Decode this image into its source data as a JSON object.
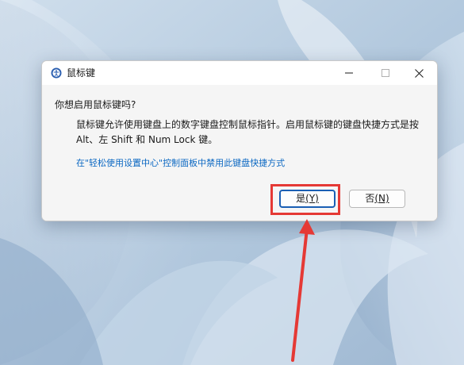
{
  "dialog": {
    "title": "鼠标键",
    "question": "你想启用鼠标键吗?",
    "description": "鼠标键允许使用键盘上的数字键盘控制鼠标指针。启用鼠标键的键盘快捷方式是按 Alt、左 Shift 和 Num Lock 键。",
    "link": "在\"轻松使用设置中心\"控制面板中禁用此键盘快捷方式",
    "yes_button": {
      "label": "是",
      "accel": "(Y)"
    },
    "no_button": {
      "label": "否",
      "accel": "(N)"
    }
  },
  "window_controls": [
    "minimize-icon",
    "maximize-icon",
    "close-icon"
  ],
  "colors": {
    "link": "#0a67c2",
    "highlight": "#e53935",
    "default_button_border": "#1a5fb4"
  }
}
